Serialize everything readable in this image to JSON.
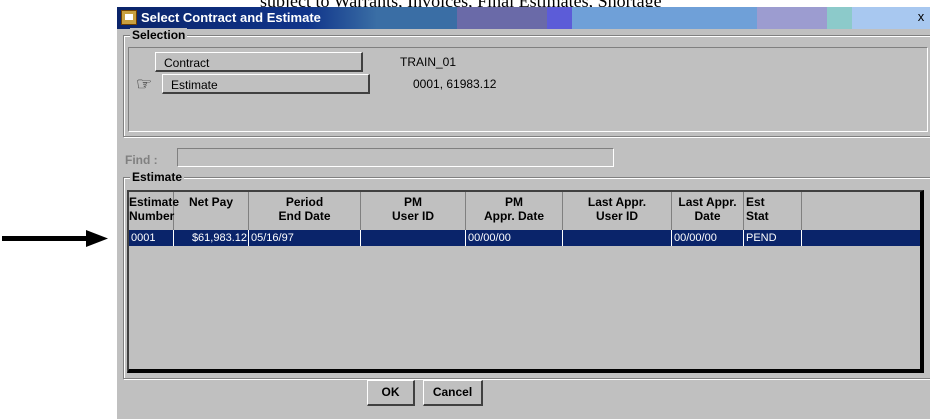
{
  "page_partial_text": "subject to Warrants, Invoices, Final Estimates, Shortage",
  "window": {
    "title": "Select Contract and Estimate",
    "close_glyph": "x"
  },
  "selection": {
    "group_label": "Selection",
    "contract_button": "Contract",
    "contract_value": "TRAIN_01",
    "estimate_button": "Estimate",
    "estimate_value": "0001, 61983.12"
  },
  "find": {
    "label": "Find :",
    "value": ""
  },
  "estimate": {
    "group_label": "Estimate",
    "columns": [
      {
        "line1": "Estimate",
        "line2": "Number"
      },
      {
        "line1": "Net Pay",
        "line2": ""
      },
      {
        "line1": "Period",
        "line2": "End Date"
      },
      {
        "line1": "PM",
        "line2": "User ID"
      },
      {
        "line1": "PM",
        "line2": "Appr. Date"
      },
      {
        "line1": "Last Appr.",
        "line2": "User ID"
      },
      {
        "line1": "Last Appr.",
        "line2": "Date"
      },
      {
        "line1": "Est",
        "line2": "Stat"
      }
    ],
    "rows": [
      {
        "estimate_number": "0001",
        "net_pay": "$61,983.12",
        "period_end_date": "05/16/97",
        "pm_user_id": "",
        "pm_appr_date": "00/00/00",
        "last_appr_user_id": "",
        "last_appr_date": "00/00/00",
        "est_stat": "PEND"
      }
    ]
  },
  "buttons": {
    "ok": "OK",
    "cancel": "Cancel"
  },
  "icons": {
    "window_icon": "app-icon",
    "pointer": "pointing-hand-icon",
    "row_marker": "arrow-right-icon"
  },
  "colors": {
    "title_bar": "#0a246a",
    "dialog_face": "#c0c0c0",
    "selected_row": "#0a246a"
  }
}
